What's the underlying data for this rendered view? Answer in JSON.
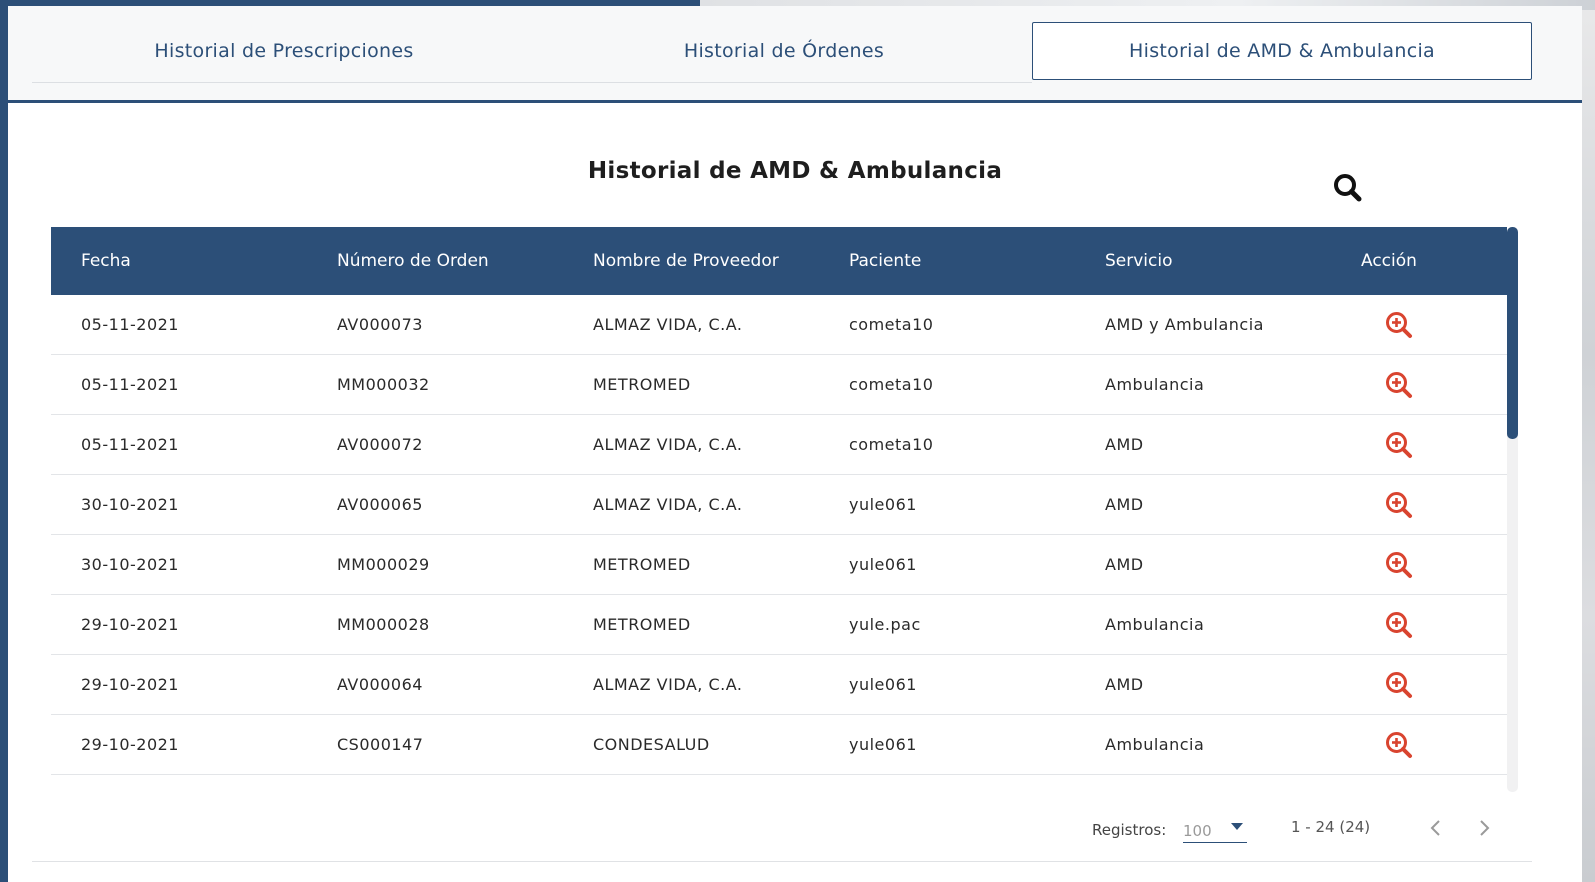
{
  "tabs": [
    {
      "label": "Historial de Prescripciones"
    },
    {
      "label": "Historial de Órdenes"
    },
    {
      "label": "Historial de AMD & Ambulancia"
    }
  ],
  "page_title": "Historial de AMD & Ambulancia",
  "table": {
    "headers": [
      "Fecha",
      "Número de Orden",
      "Nombre de Proveedor",
      "Paciente",
      "Servicio",
      "Acción"
    ],
    "rows": [
      [
        "05-11-2021",
        "AV000073",
        "ALMAZ VIDA, C.A.",
        "cometa10",
        "AMD y Ambulancia"
      ],
      [
        "05-11-2021",
        "MM000032",
        "METROMED",
        "cometa10",
        "Ambulancia"
      ],
      [
        "05-11-2021",
        "AV000072",
        "ALMAZ VIDA, C.A.",
        "cometa10",
        "AMD"
      ],
      [
        "30-10-2021",
        "AV000065",
        "ALMAZ VIDA, C.A.",
        "yule061",
        "AMD"
      ],
      [
        "30-10-2021",
        "MM000029",
        "METROMED",
        "yule061",
        "AMD"
      ],
      [
        "29-10-2021",
        "MM000028",
        "METROMED",
        "yule.pac",
        "Ambulancia"
      ],
      [
        "29-10-2021",
        "AV000064",
        "ALMAZ VIDA, C.A.",
        "yule061",
        "AMD"
      ],
      [
        "29-10-2021",
        "CS000147",
        "CONDESALUD",
        "yule061",
        "Ambulancia"
      ]
    ]
  },
  "pagination": {
    "records_label": "Registros:",
    "records_value": "100",
    "range": "1 - 24 (24)"
  },
  "colors": {
    "primary": "#2c4f78",
    "action_icon": "#d9442f"
  },
  "icons": {
    "search": "search-icon",
    "action": "zoom-in-icon",
    "prev": "chevron-left-icon",
    "next": "chevron-right-icon"
  }
}
